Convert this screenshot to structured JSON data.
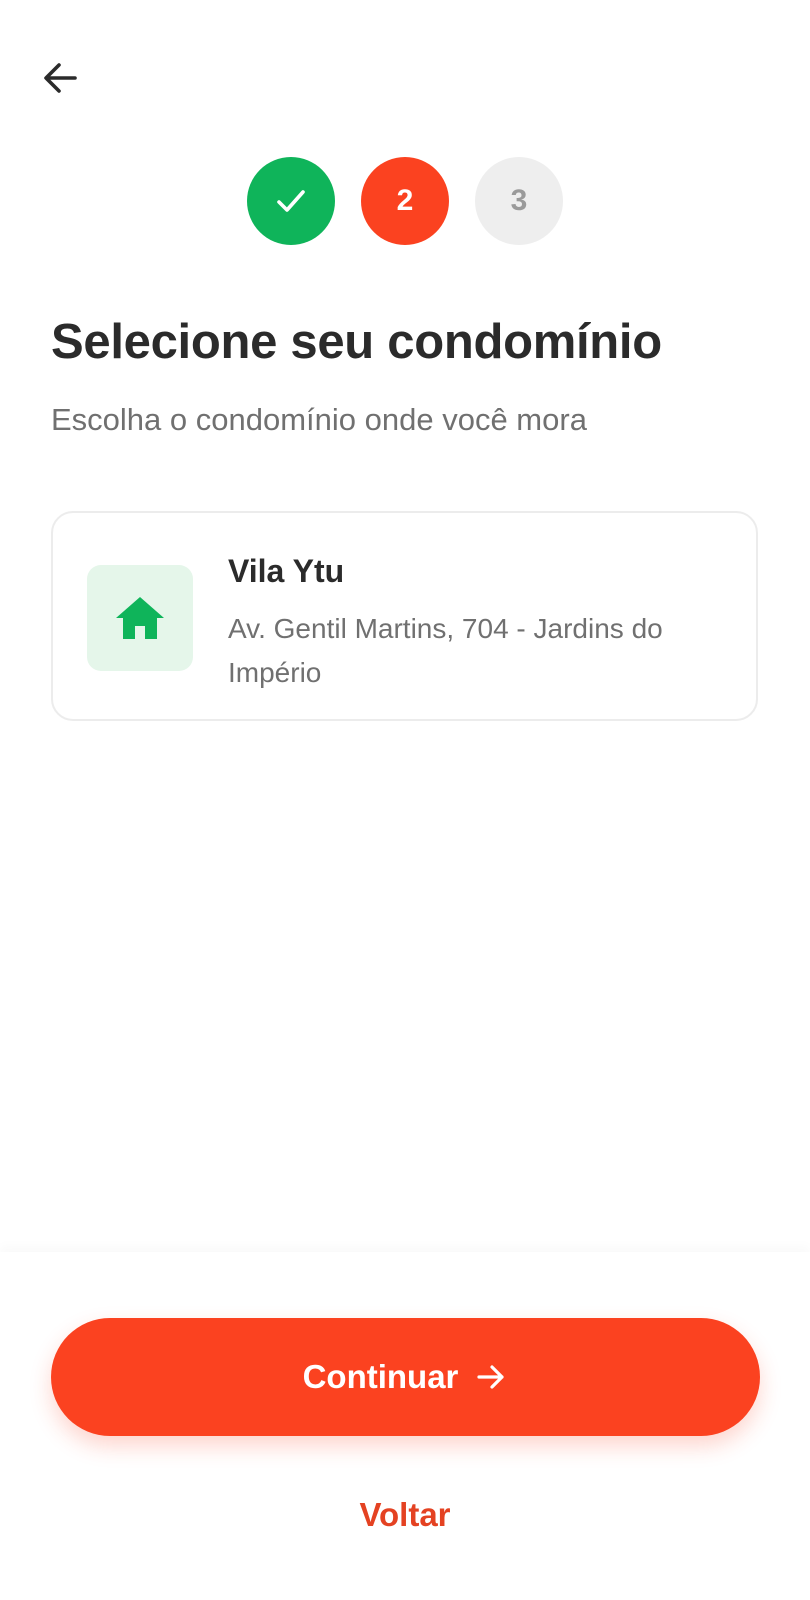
{
  "header": {
    "back_icon": "arrow-left-icon"
  },
  "stepper": {
    "steps": [
      {
        "label": "",
        "state": "completed",
        "icon": "check-icon",
        "color": "#0fb45a"
      },
      {
        "label": "2",
        "state": "active",
        "color": "#fb4220"
      },
      {
        "label": "3",
        "state": "pending",
        "color": "#eeeeee"
      }
    ]
  },
  "main": {
    "title": "Selecione seu condomínio",
    "subtitle": "Escolha o condomínio onde você mora"
  },
  "condominiums": [
    {
      "name": "Vila Ytu",
      "address": "Av. Gentil Martins, 704 - Jardins do Império",
      "icon": "home-icon"
    }
  ],
  "footer": {
    "continue_label": "Continuar",
    "continue_icon": "arrow-right-icon",
    "back_label": "Voltar"
  },
  "colors": {
    "primary": "#fb4220",
    "success": "#0fb45a",
    "text": "#2b2b2b",
    "muted": "#707070"
  }
}
